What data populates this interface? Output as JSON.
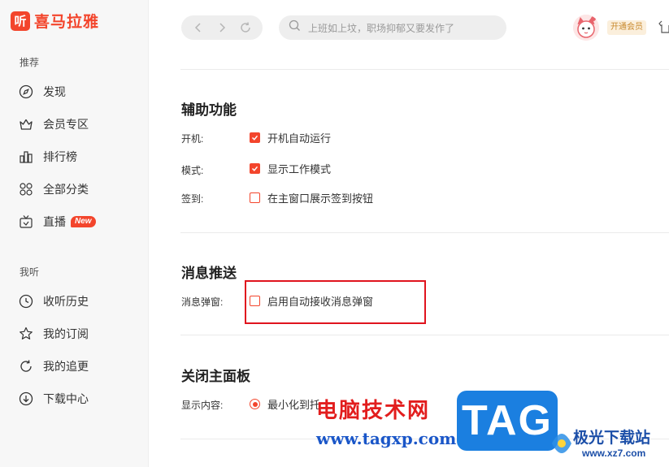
{
  "app": {
    "logo_glyph": "听",
    "logo_text": "喜马拉雅",
    "brand_color": "#f3452c"
  },
  "sidebar": {
    "section_recommend": "推荐",
    "section_mine": "我听",
    "items": [
      {
        "label": "发现",
        "icon": "compass-icon"
      },
      {
        "label": "会员专区",
        "icon": "crown-icon"
      },
      {
        "label": "排行榜",
        "icon": "ranking-icon"
      },
      {
        "label": "全部分类",
        "icon": "grid-icon"
      },
      {
        "label": "直播",
        "icon": "tv-icon",
        "badge": "New"
      },
      {
        "label": "收听历史",
        "icon": "clock-icon"
      },
      {
        "label": "我的订阅",
        "icon": "star-icon"
      },
      {
        "label": "我的追更",
        "icon": "refresh-icon"
      },
      {
        "label": "下载中心",
        "icon": "download-icon"
      }
    ]
  },
  "topbar": {
    "search_placeholder": "上班如上坟，职场抑郁又要发作了",
    "vip_label": "开通会员"
  },
  "settings": {
    "accessibility": {
      "title": "辅助功能",
      "rows": [
        {
          "label": "开机:",
          "option": "开机自动运行",
          "checked": true
        },
        {
          "label": "模式:",
          "option": "显示工作模式",
          "checked": true
        },
        {
          "label": "签到:",
          "option": "在主窗口展示签到按钮",
          "checked": false
        }
      ]
    },
    "push": {
      "title": "消息推送",
      "rows": [
        {
          "label": "消息弹窗:",
          "option": "启用自动接收消息弹窗",
          "checked": false
        }
      ]
    },
    "close_panel": {
      "title": "关闭主面板",
      "label": "显示内容:",
      "option": "最小化到托",
      "selected": true
    }
  },
  "watermark": {
    "cn": "电脑技术网",
    "url": "www.tagxp.com",
    "tag": "TAG",
    "site_cn": "极光下载站",
    "site_url": "www.xz7.com"
  }
}
